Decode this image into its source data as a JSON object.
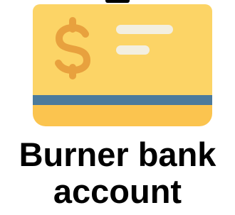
{
  "illustration": {
    "icon": "bank-card-dollar-icon",
    "colors": {
      "card_body": "#FCD466",
      "card_bottom": "#FBC44F",
      "stripe": "#4C7A9C",
      "dollar_sign": "#E8A13E",
      "text_lines": "#F3EFE0"
    }
  },
  "caption": {
    "line1": "Burner bank",
    "line2": "account",
    "color": "#000000"
  }
}
